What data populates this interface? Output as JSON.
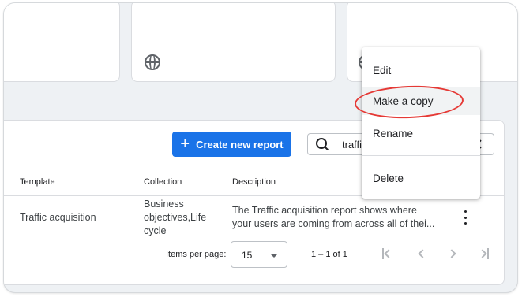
{
  "toolbar": {
    "create_label": "Create new report",
    "create_icon": "plus-icon",
    "search_value": "traffi"
  },
  "table": {
    "columns": [
      "Template",
      "Collection",
      "Description"
    ],
    "rows": [
      {
        "template": "Traffic acquisition",
        "collection": "Business objectives,Life cycle",
        "description_line1": "The Traffic acquisition report shows where",
        "description_line2": "your users are coming from across all of thei..."
      }
    ]
  },
  "pagination": {
    "items_per_page_label": "Items per page:",
    "items_per_page_value": "15",
    "range_label": "1 – 1 of 1"
  },
  "context_menu": {
    "items": [
      "Edit",
      "Make a copy",
      "Rename",
      "Delete"
    ]
  },
  "colors": {
    "primary": "#1a73e8",
    "annotation": "#e53935"
  }
}
